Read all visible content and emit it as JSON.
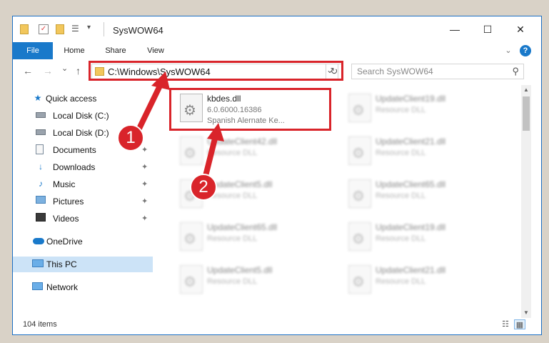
{
  "titlebar": {
    "title": "SysWOW64",
    "minimize_glyph": "—",
    "maximize_glyph": "☐",
    "close_glyph": "✕",
    "quick_icons": [
      "folder-icon",
      "properties-icon",
      "new-folder-icon",
      "customize-icon",
      "dropdown-icon"
    ]
  },
  "ribbon": {
    "tabs": [
      "File",
      "Home",
      "Share",
      "View"
    ],
    "expand_glyph": "⌄",
    "help_glyph": "?"
  },
  "nav": {
    "back_glyph": "←",
    "forward_glyph": "→",
    "recent_glyph": "⌄",
    "up_glyph": "↑",
    "address": "C:\\Windows\\SysWOW64",
    "address_dropdown_glyph": "⌄",
    "refresh_glyph": "↻",
    "search_placeholder": "Search SysWOW64",
    "search_glyph": "⚲"
  },
  "sidebar": {
    "items": [
      {
        "label": "Quick access",
        "icon": "star-icon"
      },
      {
        "label": "Local Disk (C:)",
        "icon": "drive-icon",
        "pinned": true
      },
      {
        "label": "Local Disk (D:)",
        "icon": "drive-icon",
        "pinned": true
      },
      {
        "label": "Documents",
        "icon": "documents-icon",
        "pinned": true
      },
      {
        "label": "Downloads",
        "icon": "downloads-icon",
        "pinned": true
      },
      {
        "label": "Music",
        "icon": "music-icon",
        "pinned": true
      },
      {
        "label": "Pictures",
        "icon": "pictures-icon",
        "pinned": true
      },
      {
        "label": "Videos",
        "icon": "videos-icon",
        "pinned": true
      },
      {
        "label": "OneDrive",
        "icon": "onedrive-icon"
      },
      {
        "label": "This PC",
        "icon": "this-pc-icon",
        "selected": true
      },
      {
        "label": "Network",
        "icon": "network-icon"
      }
    ],
    "pin_glyph": "📌"
  },
  "files": {
    "focused": {
      "name": "kbdes.dll",
      "version": "6.0.6000.16386",
      "description": "Spanish Alernate Ke..."
    },
    "blurred": [
      {
        "name": "UpdateClient19.dll",
        "type": "Resource DLL"
      },
      {
        "name": "UpdateClient42.dll",
        "type": "Resource DLL"
      },
      {
        "name": "UpdateClient21.dll",
        "type": "Resource DLL"
      },
      {
        "name": "UpdateClient5.dll",
        "type": "Resource DLL"
      },
      {
        "name": "UpdateClient65.dll",
        "type": "Resource DLL"
      },
      {
        "name": "UpdateClient65.dll",
        "type": "Resource DLL"
      },
      {
        "name": "UpdateClient19.dll",
        "type": "Resource DLL"
      },
      {
        "name": "UpdateClient5.dll",
        "type": "Resource DLL"
      },
      {
        "name": "UpdateClient21.dll",
        "type": "Resource DLL"
      }
    ]
  },
  "status": {
    "item_count": "104 items"
  },
  "callouts": [
    "1",
    "2"
  ],
  "colors": {
    "accent": "#1979ca",
    "highlight": "#d9242a",
    "selected": "#cce3f7"
  }
}
